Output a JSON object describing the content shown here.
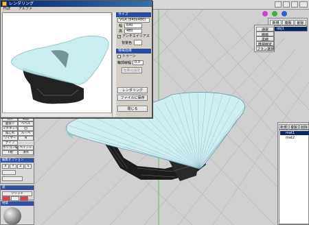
{
  "render_window": {
    "title": "レンダリング",
    "menu": [
      "FILE",
      "アルファ"
    ],
    "size_header": "サイズ",
    "size_select": "VGA (640x480)",
    "width_label": "幅",
    "width_value": "640",
    "height_label": "高",
    "height_value": "480",
    "antialias_label": "アンチエイリアス",
    "antialias_checked": true,
    "bg_label": "背景色",
    "spec_header": "特殊効果",
    "toon_label": "トゥーン",
    "outline_label": "輪郭線幅",
    "outline_value": "0.3",
    "effects_button": "効果の設定",
    "render_button": "レンダリング",
    "save_button": "ファイルに保存",
    "close_button": "閉じる"
  },
  "top_right_panel": {
    "tabs": [
      "新規",
      "複製",
      "削除"
    ],
    "buttons": [
      "通常",
      "線画",
      "黒線",
      "微視線定",
      "ブラン選択"
    ],
    "items": [
      {
        "label": "obj1",
        "selected": true
      }
    ]
  },
  "material_panel": {
    "tabs": [
      "新規",
      "複製",
      "削除"
    ],
    "items": [
      {
        "label": "mat1",
        "selected": true
      },
      {
        "label": "mat2",
        "selected": false
      }
    ]
  },
  "left_tools": {
    "edit_head": "",
    "rows": [
      [
        "選択",
        "範囲"
      ],
      [
        "選択",
        "範囲"
      ],
      [
        "面張り",
        "ベベル"
      ],
      [
        "マグネット",
        "回"
      ],
      [
        "ねじれ",
        "ルーペ"
      ],
      [
        "ワイヤー",
        "N"
      ],
      [
        "ナイフ",
        ""
      ],
      [
        "ポリゴン転生",
        "ペイント"
      ],
      [
        "下絵",
        "頂点"
      ]
    ],
    "edit_option_head": "編集オプション",
    "axis": [
      "X",
      "Y",
      "Z",
      "S"
    ],
    "perspective_head": "表",
    "perspective_items": [
      "ソリッド",
      "ワイヤ"
    ],
    "material_head": "材質"
  },
  "colors": {
    "window_bg": "#d4d0c8",
    "title_bar": "#0a246a",
    "selection": "#0a246a",
    "grid": "#b8b8b8",
    "table_top": "#cfeef2",
    "table_edge": "#6a9aa8",
    "table_base": "#1a1a1a"
  }
}
